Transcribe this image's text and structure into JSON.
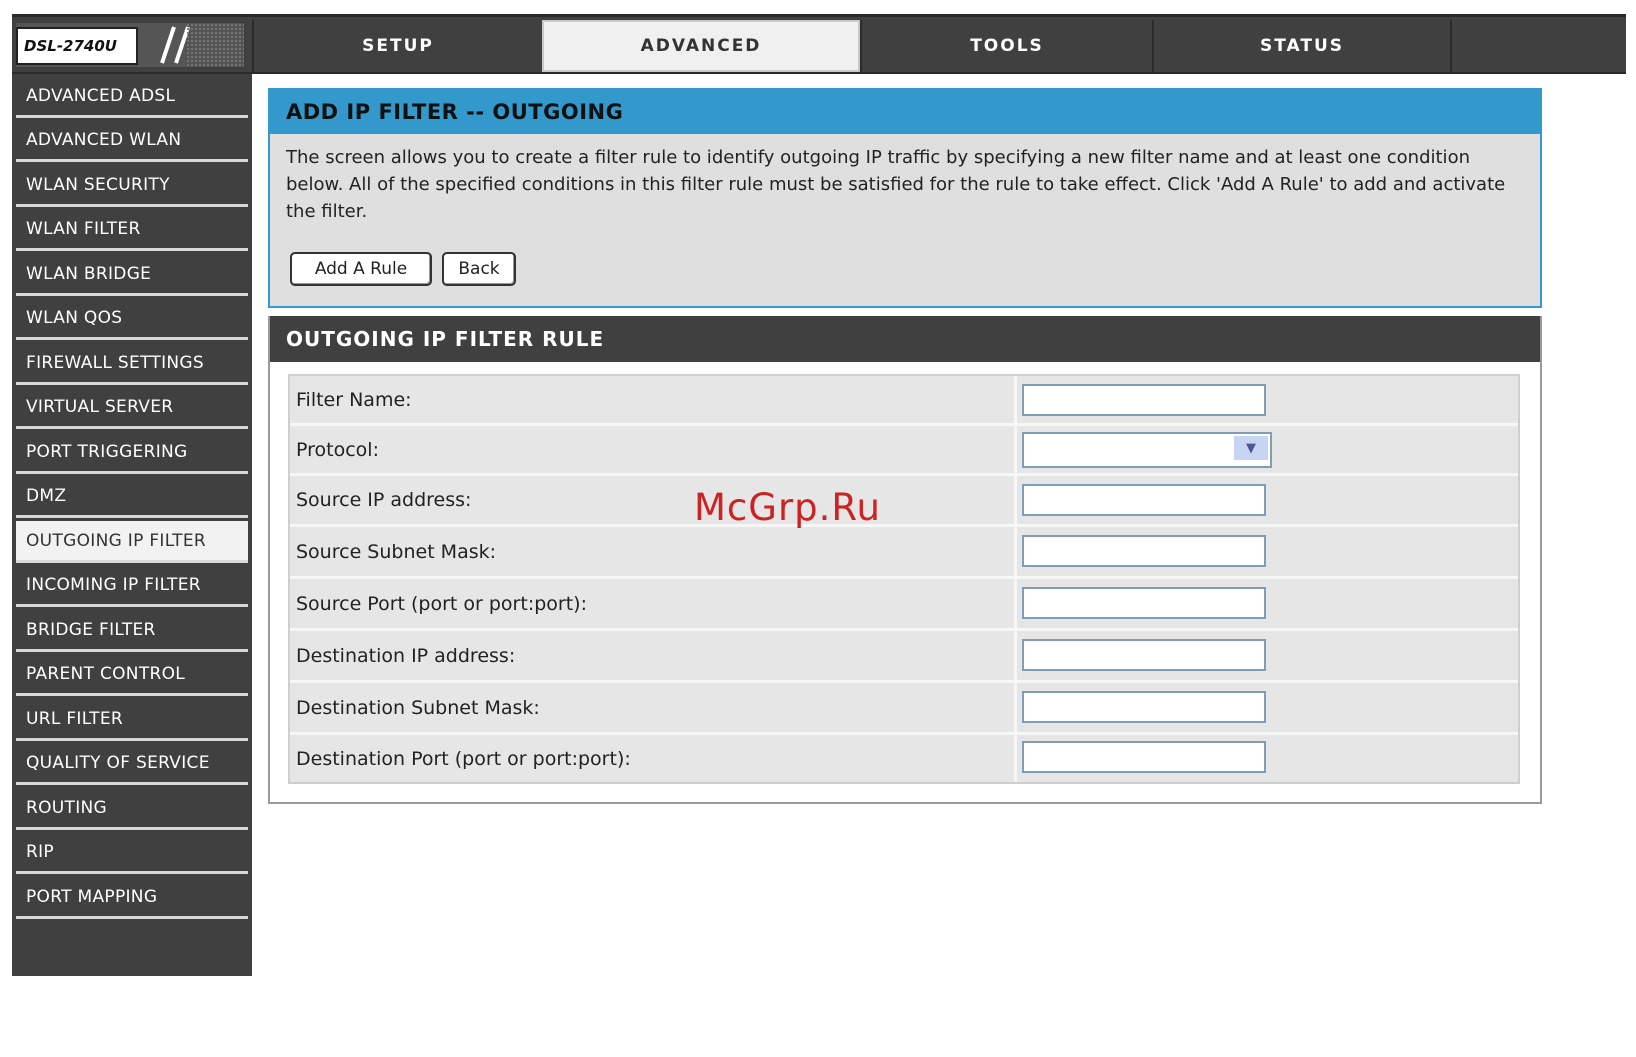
{
  "brand": {
    "model": "DSL-2740U"
  },
  "tabs": [
    {
      "label": "SETUP"
    },
    {
      "label": "ADVANCED"
    },
    {
      "label": "TOOLS"
    },
    {
      "label": "STATUS"
    }
  ],
  "sidebar": {
    "items": [
      {
        "label": "ADVANCED ADSL"
      },
      {
        "label": "ADVANCED WLAN"
      },
      {
        "label": "WLAN SECURITY"
      },
      {
        "label": "WLAN FILTER"
      },
      {
        "label": "WLAN BRIDGE"
      },
      {
        "label": "WLAN QOS"
      },
      {
        "label": "FIREWALL SETTINGS"
      },
      {
        "label": "VIRTUAL SERVER"
      },
      {
        "label": "PORT TRIGGERING"
      },
      {
        "label": "DMZ"
      },
      {
        "label": "OUTGOING IP FILTER"
      },
      {
        "label": "INCOMING IP FILTER"
      },
      {
        "label": "BRIDGE FILTER"
      },
      {
        "label": "PARENT CONTROL"
      },
      {
        "label": "URL FILTER"
      },
      {
        "label": "QUALITY OF SERVICE"
      },
      {
        "label": "ROUTING"
      },
      {
        "label": "RIP"
      },
      {
        "label": "PORT MAPPING"
      }
    ]
  },
  "intro": {
    "title": "ADD IP FILTER -- OUTGOING",
    "description": "The screen allows you to create a filter rule to identify outgoing IP traffic by specifying a new filter name and at least one condition below. All of the specified conditions in this filter rule must be satisfied for the rule to take effect. Click 'Add A Rule' to add and activate the filter.",
    "add_button": "Add A Rule",
    "back_button": "Back"
  },
  "rule": {
    "title": "OUTGOING IP FILTER RULE",
    "fields": [
      {
        "label": "Filter Name:",
        "value": ""
      },
      {
        "label": "Protocol:",
        "value": ""
      },
      {
        "label": "Source IP address:",
        "value": ""
      },
      {
        "label": "Source Subnet Mask:",
        "value": ""
      },
      {
        "label": "Source Port (port or port:port):",
        "value": ""
      },
      {
        "label": "Destination IP address:",
        "value": ""
      },
      {
        "label": "Destination Subnet Mask:",
        "value": ""
      },
      {
        "label": "Destination Port (port or port:port):",
        "value": ""
      }
    ]
  },
  "watermark": "McGrp.Ru",
  "icons": {
    "protocol_dropdown": "chevron-down-icon"
  },
  "colors": {
    "accent": "#3399cc",
    "dark_bar": "#404040",
    "watermark": "#cc2222"
  }
}
